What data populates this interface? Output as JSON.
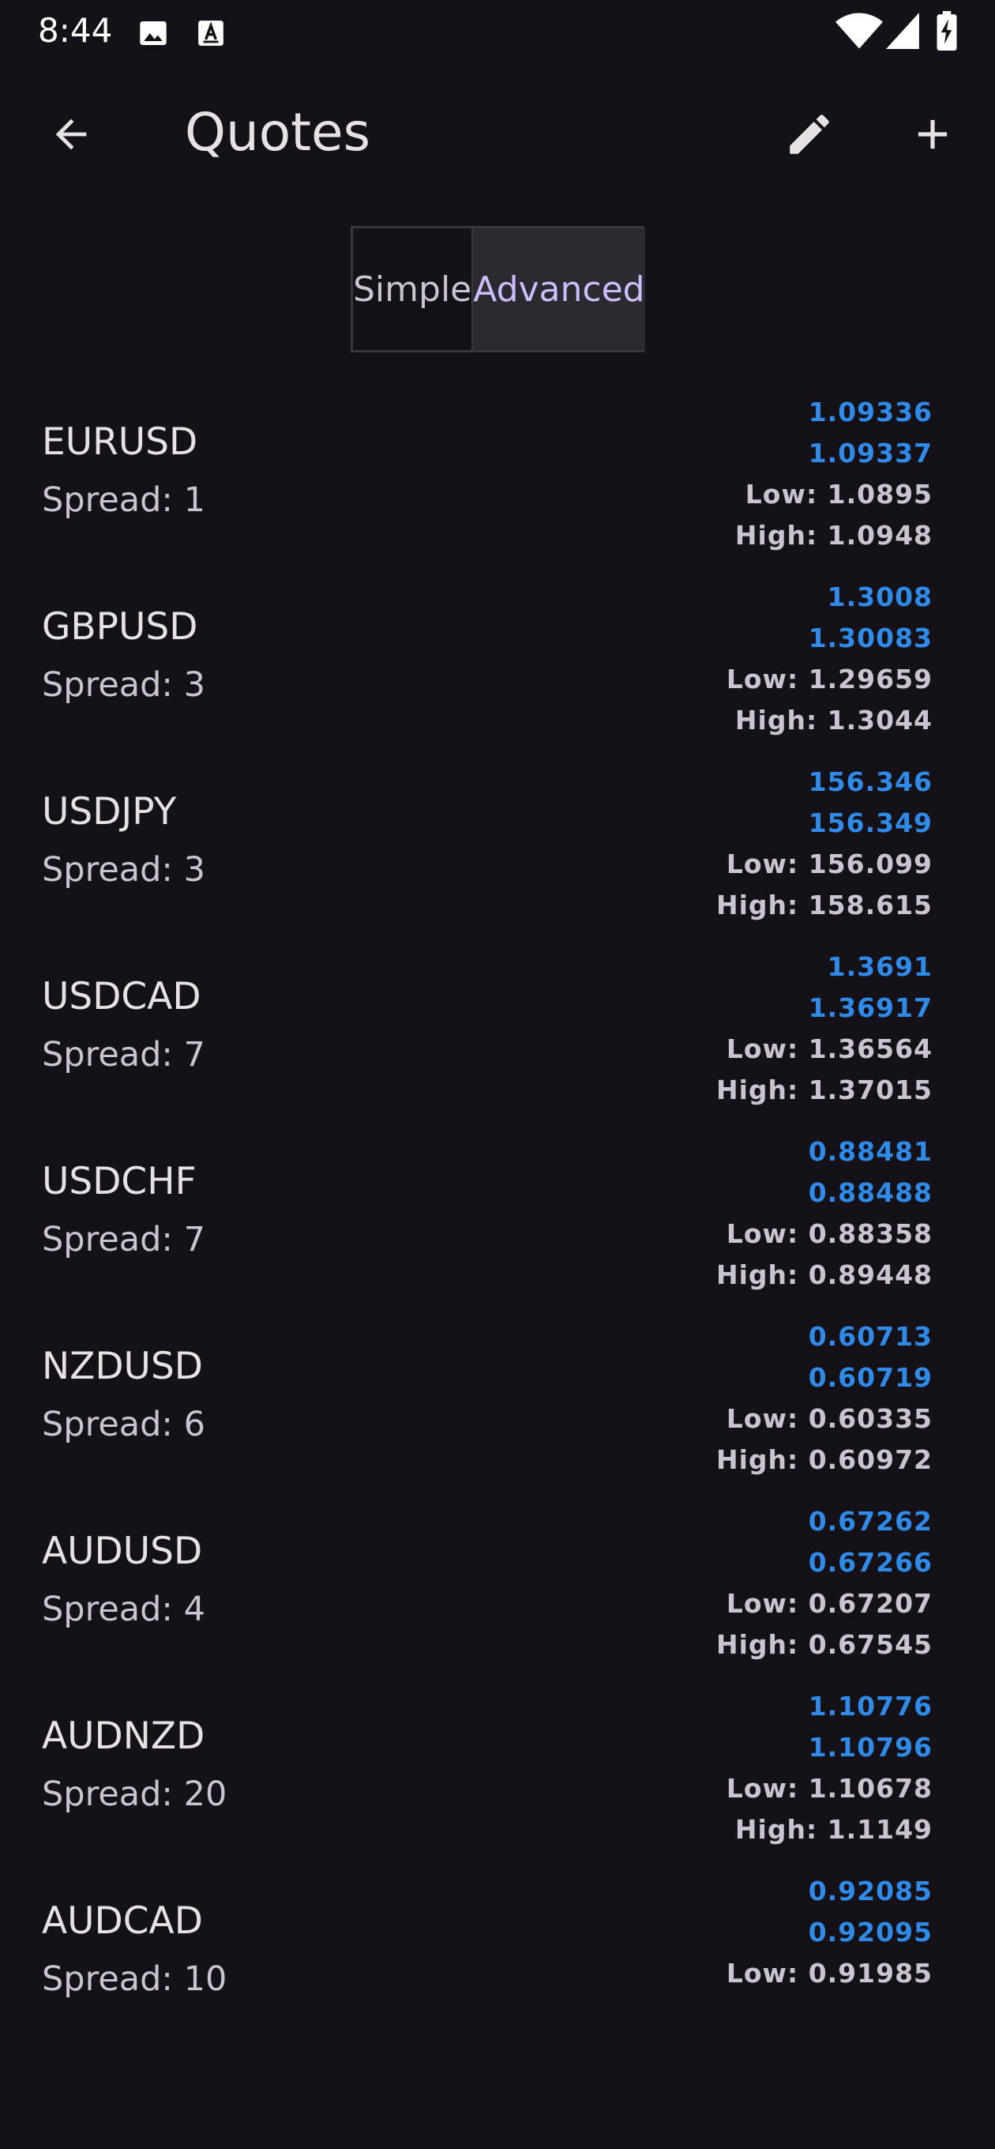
{
  "status_bar": {
    "time": "8:44",
    "icons": [
      "image-icon",
      "text-box-icon",
      "wifi-icon",
      "signal-icon",
      "battery-charging-icon"
    ]
  },
  "app_bar": {
    "title": "Quotes",
    "icons": {
      "back": "arrow-left-icon",
      "edit": "pencil-icon",
      "add": "plus-icon"
    }
  },
  "view_toggle": {
    "options": [
      "Simple",
      "Advanced"
    ],
    "selected": "Advanced"
  },
  "labels": {
    "spread": "Spread: ",
    "low": "Low: ",
    "high": "High: "
  },
  "quotes": [
    {
      "symbol": "EURUSD",
      "spread": "1",
      "bid": "1.09336",
      "ask": "1.09337",
      "low": "1.0895",
      "high": "1.0948"
    },
    {
      "symbol": "GBPUSD",
      "spread": "3",
      "bid": "1.3008",
      "ask": "1.30083",
      "low": "1.29659",
      "high": "1.3044"
    },
    {
      "symbol": "USDJPY",
      "spread": "3",
      "bid": "156.346",
      "ask": "156.349",
      "low": "156.099",
      "high": "158.615"
    },
    {
      "symbol": "USDCAD",
      "spread": "7",
      "bid": "1.3691",
      "ask": "1.36917",
      "low": "1.36564",
      "high": "1.37015"
    },
    {
      "symbol": "USDCHF",
      "spread": "7",
      "bid": "0.88481",
      "ask": "0.88488",
      "low": "0.88358",
      "high": "0.89448"
    },
    {
      "symbol": "NZDUSD",
      "spread": "6",
      "bid": "0.60713",
      "ask": "0.60719",
      "low": "0.60335",
      "high": "0.60972"
    },
    {
      "symbol": "AUDUSD",
      "spread": "4",
      "bid": "0.67262",
      "ask": "0.67266",
      "low": "0.67207",
      "high": "0.67545"
    },
    {
      "symbol": "AUDNZD",
      "spread": "20",
      "bid": "1.10776",
      "ask": "1.10796",
      "low": "1.10678",
      "high": "1.1149"
    },
    {
      "symbol": "AUDCAD",
      "spread": "10",
      "bid": "0.92085",
      "ask": "0.92095",
      "low": "0.91985"
    }
  ],
  "colors": {
    "background": "#141218",
    "price_blue": "#2f8ae8",
    "accent_purple": "#cdbdfb",
    "text_primary": "#e6e1e5",
    "text_secondary": "#cac4d0"
  }
}
